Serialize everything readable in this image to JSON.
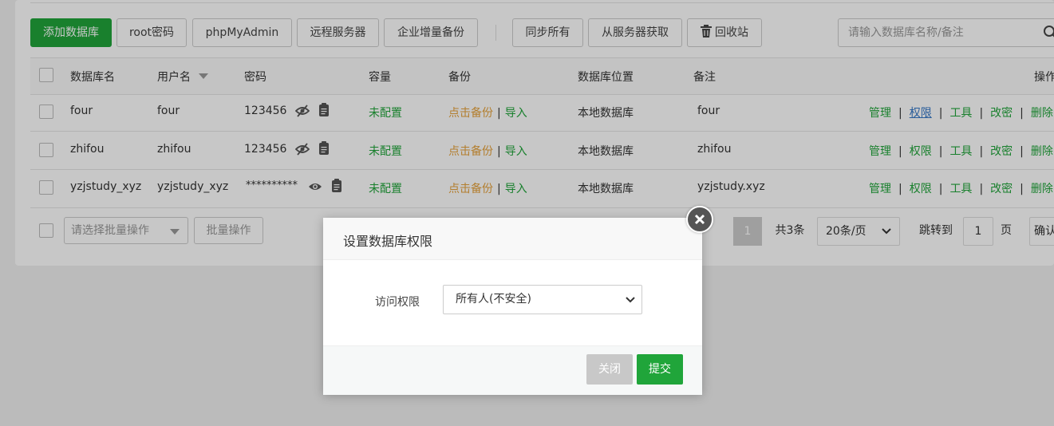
{
  "toolbar": {
    "add_db": "添加数据库",
    "root_pwd": "root密码",
    "phpmyadmin": "phpMyAdmin",
    "remote_server": "远程服务器",
    "enterprise_backup": "企业增量备份",
    "sync_all": "同步所有",
    "fetch_from_server": "从服务器获取",
    "recycle_bin": "回收站",
    "search_placeholder": "请输入数据库名称/备注"
  },
  "table": {
    "columns": [
      "数据库名",
      "用户名",
      "密码",
      "容量",
      "备份",
      "数据库位置",
      "备注",
      "操作"
    ],
    "rows": [
      {
        "name": "four",
        "user": "four",
        "password": "123456",
        "capacity": "未配置",
        "backup": "点击备份",
        "import": "导入",
        "location": "本地数据库",
        "remark": "four"
      },
      {
        "name": "zhifou",
        "user": "zhifou",
        "password": "123456",
        "capacity": "未配置",
        "backup": "点击备份",
        "import": "导入",
        "location": "本地数据库",
        "remark": "zhifou"
      },
      {
        "name": "yzjstudy_xyz",
        "user": "yzjstudy_xyz",
        "password": "**********",
        "capacity": "未配置",
        "backup": "点击备份",
        "import": "导入",
        "location": "本地数据库",
        "remark": "yzjstudy.xyz"
      }
    ],
    "ops": [
      "管理",
      "权限",
      "工具",
      "改密",
      "删除"
    ]
  },
  "footer": {
    "batch_select_placeholder": "请选择批量操作",
    "batch_button": "批量操作",
    "current_page": "1",
    "total": "共3条",
    "page_size": "20条/页",
    "goto_label": "跳转到",
    "goto_value": "1",
    "page_unit": "页",
    "confirm": "确认"
  },
  "modal": {
    "title": "设置数据库权限",
    "field_label": "访问权限",
    "field_value": "所有人(不安全)",
    "close_label": "关闭",
    "submit_label": "提交"
  },
  "colors": {
    "accent": "#20a53a",
    "orange": "#e6a23c",
    "link_blue": "#3477c6"
  }
}
